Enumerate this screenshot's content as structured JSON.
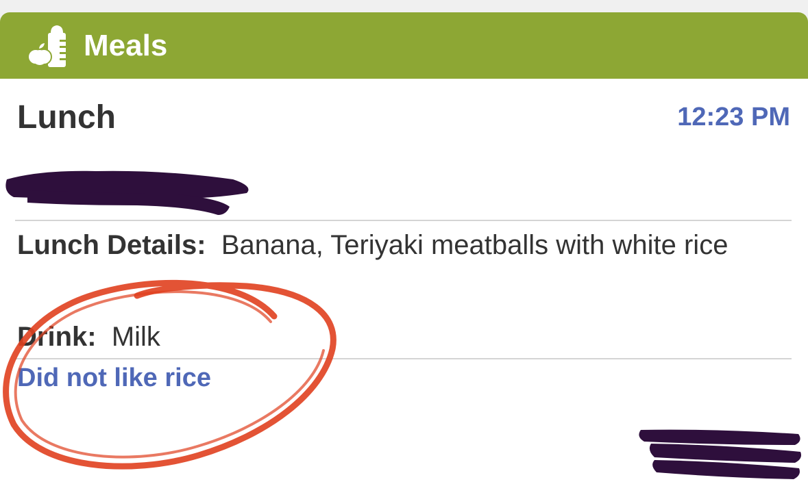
{
  "header": {
    "title": "Meals",
    "icon": "meals-icon",
    "color": "#8da734"
  },
  "entry": {
    "meal_type": "Lunch",
    "time": "12:23 PM",
    "details_label": "Lunch Details:",
    "details_value": "Banana, Teriyaki meatballs with white rice",
    "drink_label": "Drink:",
    "drink_value": "Milk",
    "note": "Did not like rice"
  },
  "colors": {
    "accent_blue": "#4f68b7",
    "redaction": "#2e0f3c",
    "annotation_red": "#e0401f"
  }
}
